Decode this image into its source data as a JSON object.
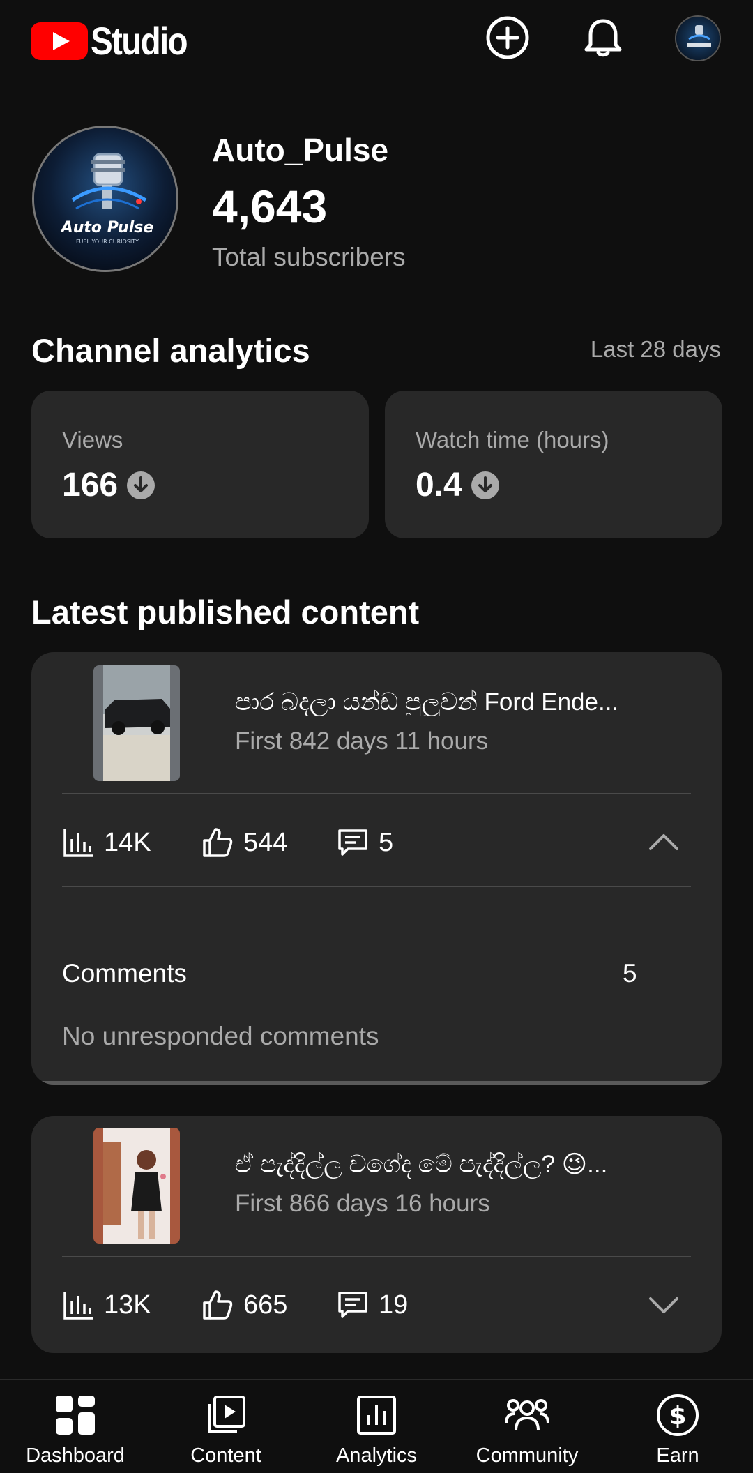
{
  "header": {
    "app_title": "Studio",
    "icons": [
      "youtube-play-icon",
      "create-icon",
      "notifications-icon"
    ]
  },
  "channel": {
    "name": "Auto_Pulse",
    "subscribers": "4,643",
    "subscribers_label": "Total subscribers",
    "logo_text": "Auto Pulse",
    "logo_tagline": "FUEL YOUR CURIOSITY"
  },
  "analytics": {
    "title": "Channel analytics",
    "period": "Last 28 days",
    "cards": [
      {
        "label": "Views",
        "value": "166",
        "trend_icon": "arrow-down-circle-icon"
      },
      {
        "label": "Watch time (hours)",
        "value": "0.4",
        "trend_icon": "arrow-down-circle-icon"
      }
    ]
  },
  "latest": {
    "title": "Latest published content",
    "videos": [
      {
        "title": "පාර බදලා යන්ඩ පුලුවන් Ford Ende...",
        "subtitle": "First 842 days 11 hours",
        "views": "14K",
        "likes": "544",
        "comments": "5",
        "expanded": true,
        "comments_label": "Comments",
        "comments_count": "5",
        "unresponded": "No unresponded comments"
      },
      {
        "title": "ඒ පැද්දිල්ල වගේද මේ පැද්දිල්ල? 😉...",
        "subtitle": "First 866 days 16 hours",
        "views": "13K",
        "likes": "665",
        "comments": "19",
        "expanded": false
      }
    ]
  },
  "nav": {
    "items": [
      {
        "label": "Dashboard",
        "icon": "dashboard-icon"
      },
      {
        "label": "Content",
        "icon": "content-icon"
      },
      {
        "label": "Analytics",
        "icon": "analytics-icon"
      },
      {
        "label": "Community",
        "icon": "community-icon"
      },
      {
        "label": "Earn",
        "icon": "earn-icon"
      }
    ]
  },
  "colors": {
    "background": "#0f0f0f",
    "card": "#282828",
    "brand_red": "#ff0000",
    "secondary_text": "#aaaaaa"
  }
}
